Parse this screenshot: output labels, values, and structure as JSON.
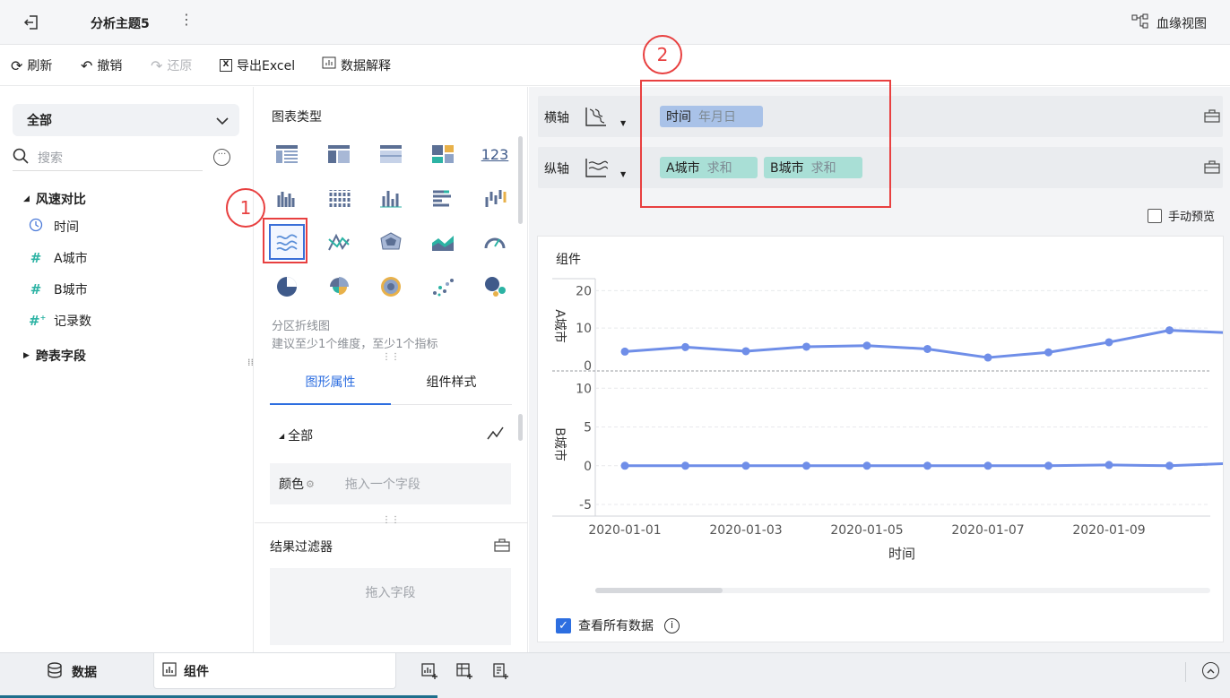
{
  "topbar": {
    "title": "分析主题5",
    "lineage": "血缘视图"
  },
  "toolbar": {
    "refresh": "刷新",
    "undo": "撤销",
    "redo": "还原",
    "export": "导出Excel",
    "explain": "数据解释"
  },
  "left": {
    "dropdown": "全部",
    "search_placeholder": "搜索",
    "table1": "风速对比",
    "fields": [
      {
        "icon": "clock",
        "label": "时间"
      },
      {
        "icon": "hash",
        "label": "A城市"
      },
      {
        "icon": "hash",
        "label": "B城市"
      },
      {
        "icon": "hash-plus",
        "label": "记录数"
      }
    ],
    "table2": "跨表字段"
  },
  "mid": {
    "chart_types_title": "图表类型",
    "type_name": "分区折线图",
    "type_hint": "建议至少1个维度，至少1个指标",
    "tab_attr": "图形属性",
    "tab_style": "组件样式",
    "all_label": "全部",
    "color_label": "颜色",
    "color_drop": "拖入一个字段",
    "filter_title": "结果过滤器",
    "filter_drop": "拖入字段",
    "chart_icon_123": "123"
  },
  "axes": {
    "x_label": "横轴",
    "y_label": "纵轴",
    "x_pill": {
      "name": "时间",
      "sub": "年月日"
    },
    "y_pills": [
      {
        "name": "A城市",
        "sub": "求和"
      },
      {
        "name": "B城市",
        "sub": "求和"
      }
    ],
    "manual_preview": "手动预览"
  },
  "annotations": {
    "one": "1",
    "two": "2"
  },
  "chart_panel": {
    "title": "组件",
    "view_all": "查看所有数据"
  },
  "chart_data": {
    "type": "line",
    "xlabel": "时间",
    "x": [
      "2020-01-01",
      "2020-01-02",
      "2020-01-03",
      "2020-01-04",
      "2020-01-05",
      "2020-01-06",
      "2020-01-07",
      "2020-01-08",
      "2020-01-09",
      "2020-01-10",
      "2020-01-11"
    ],
    "x_tick_labels": [
      "2020-01-01",
      "2020-01-03",
      "2020-01-05",
      "2020-01-07",
      "2020-01-09"
    ],
    "series": [
      {
        "name": "A城市",
        "values": [
          3.7,
          4.9,
          3.8,
          5.0,
          5.3,
          4.4,
          2.1,
          3.5,
          6.2,
          9.4,
          8.7
        ],
        "yticks": [
          0,
          10,
          20
        ],
        "ylim": [
          -1,
          22
        ]
      },
      {
        "name": "B城市",
        "values": [
          0,
          0,
          0,
          0,
          0,
          0,
          0,
          0,
          0.1,
          0,
          0.3
        ],
        "yticks": [
          -5,
          0,
          5,
          10
        ],
        "ylim": [
          -6.5,
          12
        ]
      }
    ],
    "color": "#6f8ee8"
  },
  "bottom": {
    "data_tab": "数据",
    "component_tab": "组件"
  }
}
